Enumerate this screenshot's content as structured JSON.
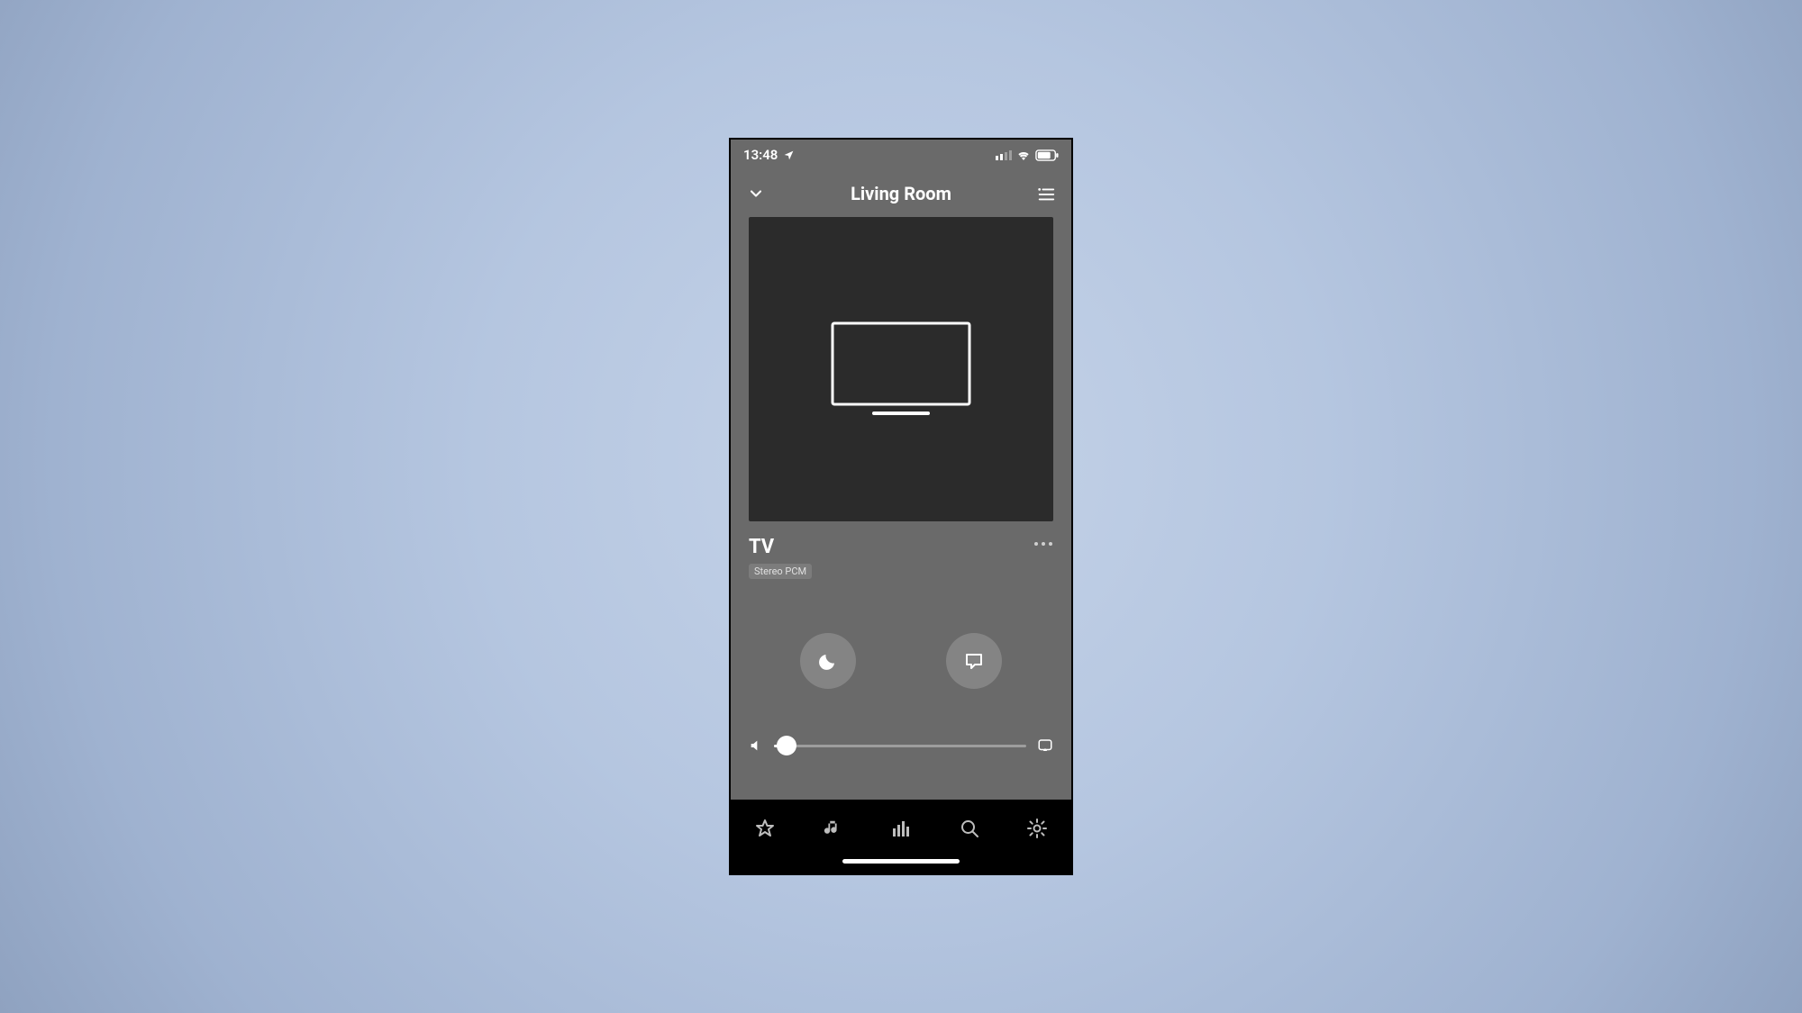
{
  "statusbar": {
    "time": "13:48"
  },
  "header": {
    "title": "Living Room"
  },
  "source": {
    "name": "TV",
    "format_badge": "Stereo PCM"
  },
  "volume": {
    "percent": 5
  }
}
